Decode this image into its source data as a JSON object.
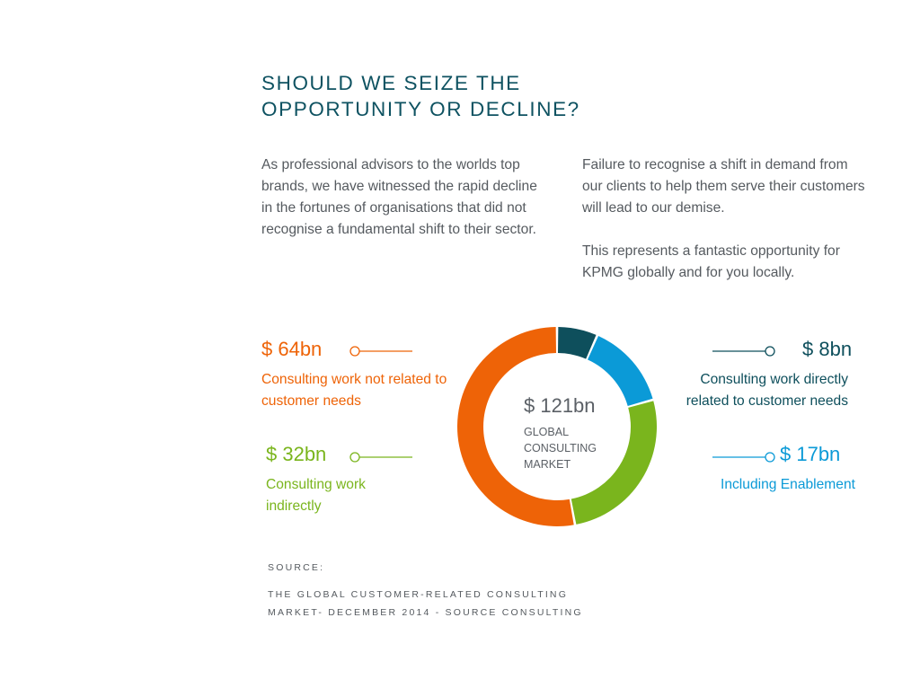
{
  "page": {
    "title": "SHOULD WE SEIZE THE OPPORTUNITY OR DECLINE?",
    "paragraph_left": "As professional advisors to the worlds top brands, we have witnessed the rapid decline in the fortunes of organisations that did not recognise a fundamental shift to their sector.",
    "paragraph_right_1": "Failure to recognise a shift in demand from our clients to help them serve their customers will lead to our demise.",
    "paragraph_right_2": "This represents a fantastic opportunity for KPMG globally and for you locally.",
    "source_label": "SOURCE:",
    "source_line_1": "THE GLOBAL CUSTOMER-RELATED CONSULTING",
    "source_line_2": "MARKET- DECEMBER 2014 - SOURCE CONSULTING"
  },
  "chart_data": {
    "type": "pie",
    "center_value": "$ 121bn",
    "center_label": "GLOBAL CONSULTING MARKET",
    "total": 121,
    "segments": [
      {
        "value": 8,
        "display": "$ 8bn",
        "label": "Consulting work directly related to customer needs",
        "color": "#0e4f5c"
      },
      {
        "value": 17,
        "display": "$ 17bn",
        "label": "Including Enablement",
        "color": "#0b9ad7"
      },
      {
        "value": 32,
        "display": "$ 32bn",
        "label": "Consulting work indirectly",
        "color": "#7ab51d"
      },
      {
        "value": 64,
        "display": "$ 64bn",
        "label": "Consulting work not related to customer needs",
        "color": "#ee6307"
      }
    ]
  }
}
